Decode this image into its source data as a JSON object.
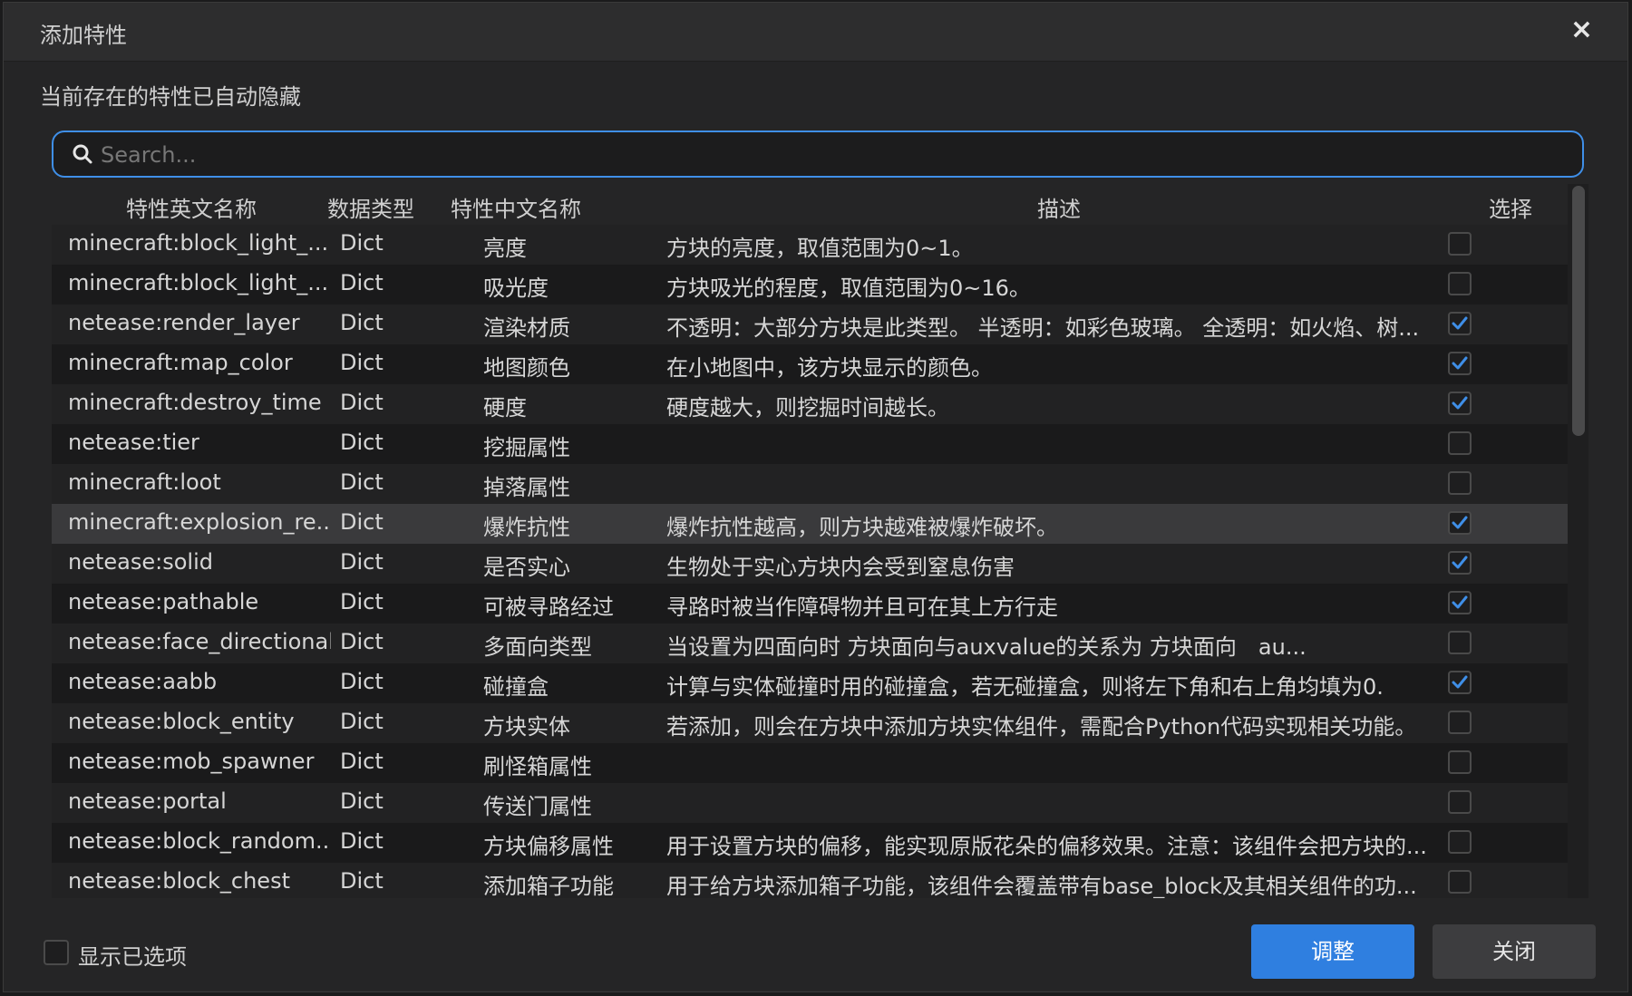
{
  "dialog": {
    "title": "添加特性",
    "close_icon": "×",
    "hint": "当前存在的特性已自动隐藏"
  },
  "search": {
    "placeholder": "Search...",
    "value": ""
  },
  "table": {
    "headers": {
      "en_name": "特性英文名称",
      "data_type": "数据类型",
      "zh_name": "特性中文名称",
      "desc": "描述",
      "select": "选择"
    },
    "rows": [
      {
        "en": "minecraft:block_light_...",
        "type": "Dict",
        "zh": "亮度",
        "desc": "方块的亮度，取值范围为0~1。",
        "checked": false
      },
      {
        "en": "minecraft:block_light_...",
        "type": "Dict",
        "zh": "吸光度",
        "desc": "方块吸光的程度，取值范围为0~16。",
        "checked": false
      },
      {
        "en": "netease:render_layer",
        "type": "Dict",
        "zh": "渲染材质",
        "desc": "不透明：大部分方块是此类型。 半透明：如彩色玻璃。 全透明：如火焰、树...",
        "checked": true
      },
      {
        "en": "minecraft:map_color",
        "type": "Dict",
        "zh": "地图颜色",
        "desc": "在小地图中，该方块显示的颜色。",
        "checked": true
      },
      {
        "en": "minecraft:destroy_time",
        "type": "Dict",
        "zh": "硬度",
        "desc": "硬度越大，则挖掘时间越长。",
        "checked": true
      },
      {
        "en": "netease:tier",
        "type": "Dict",
        "zh": "挖掘属性",
        "desc": "",
        "checked": false
      },
      {
        "en": "minecraft:loot",
        "type": "Dict",
        "zh": "掉落属性",
        "desc": "",
        "checked": false
      },
      {
        "en": "minecraft:explosion_re...",
        "type": "Dict",
        "zh": "爆炸抗性",
        "desc": "爆炸抗性越高，则方块越难被爆炸破坏。",
        "checked": true,
        "selected": true
      },
      {
        "en": "netease:solid",
        "type": "Dict",
        "zh": "是否实心",
        "desc": "生物处于实心方块内会受到窒息伤害",
        "checked": true
      },
      {
        "en": "netease:pathable",
        "type": "Dict",
        "zh": "可被寻路经过",
        "desc": "寻路时被当作障碍物并且可在其上方行走",
        "checked": true
      },
      {
        "en": "netease:face_directional",
        "type": "Dict",
        "zh": "多面向类型",
        "desc": "当设置为四面向时 方块面向与auxvalue的关系为 方块面向　au...",
        "checked": false
      },
      {
        "en": "netease:aabb",
        "type": "Dict",
        "zh": "碰撞盒",
        "desc": "计算与实体碰撞时用的碰撞盒，若无碰撞盒，则将左下角和右上角均填为0.",
        "checked": true
      },
      {
        "en": "netease:block_entity",
        "type": "Dict",
        "zh": "方块实体",
        "desc": "若添加，则会在方块中添加方块实体组件，需配合Python代码实现相关功能。",
        "checked": false
      },
      {
        "en": "netease:mob_spawner",
        "type": "Dict",
        "zh": "刷怪箱属性",
        "desc": "",
        "checked": false
      },
      {
        "en": "netease:portal",
        "type": "Dict",
        "zh": "传送门属性",
        "desc": "",
        "checked": false
      },
      {
        "en": "netease:block_random...",
        "type": "Dict",
        "zh": "方块偏移属性",
        "desc": "用于设置方块的偏移，能实现原版花朵的偏移效果。注意：该组件会把方块的...",
        "checked": false
      },
      {
        "en": "netease:block_chest",
        "type": "Dict",
        "zh": "添加箱子功能",
        "desc": "用于给方块添加箱子功能，该组件会覆盖带有base_block及其相关组件的功...",
        "checked": false
      }
    ]
  },
  "footer": {
    "show_selected_label": "显示已选项",
    "show_selected_checked": false,
    "confirm_label": "调整",
    "close_label": "关闭"
  },
  "colors": {
    "accent": "#2f7fe0",
    "check": "#3f8fe8",
    "background": "#252526"
  }
}
